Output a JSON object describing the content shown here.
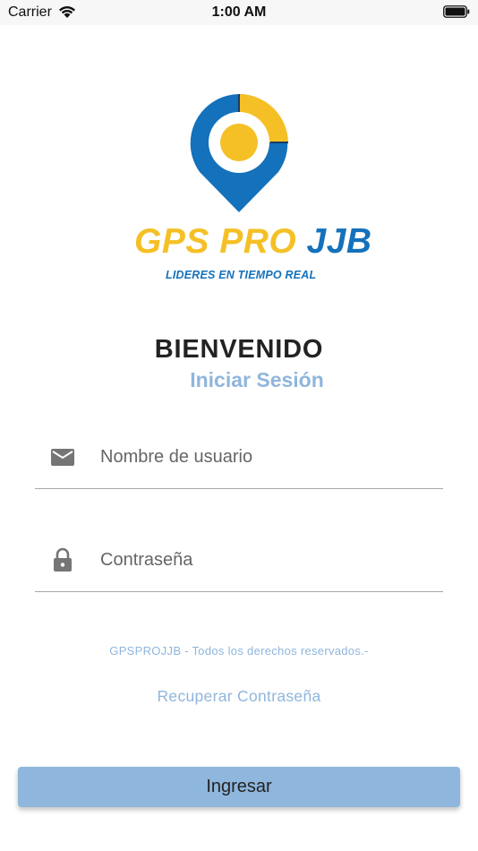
{
  "status_bar": {
    "carrier": "Carrier",
    "time": "1:00 AM"
  },
  "brand": {
    "gps_pro": "GPS PRO ",
    "jjb": "JJB",
    "tagline": "LIDERES EN TIEMPO REAL"
  },
  "header": {
    "title": "BIENVENIDO",
    "subtitle": "Iniciar Sesión"
  },
  "form": {
    "username_placeholder": "Nombre de usuario",
    "password_placeholder": "Contraseña",
    "username_value": "",
    "password_value": ""
  },
  "footer": {
    "copyright": "GPSPROJJB - Todos los derechos reservados.-",
    "recover_label": "Recuperar Contraseña",
    "login_label": "Ingresar"
  },
  "icons": {
    "username": "mail-icon",
    "password": "lock-icon"
  },
  "colors": {
    "brand_blue": "#1471bb",
    "brand_yellow": "#f5c026",
    "accent_light_blue": "#8fb6dc"
  }
}
